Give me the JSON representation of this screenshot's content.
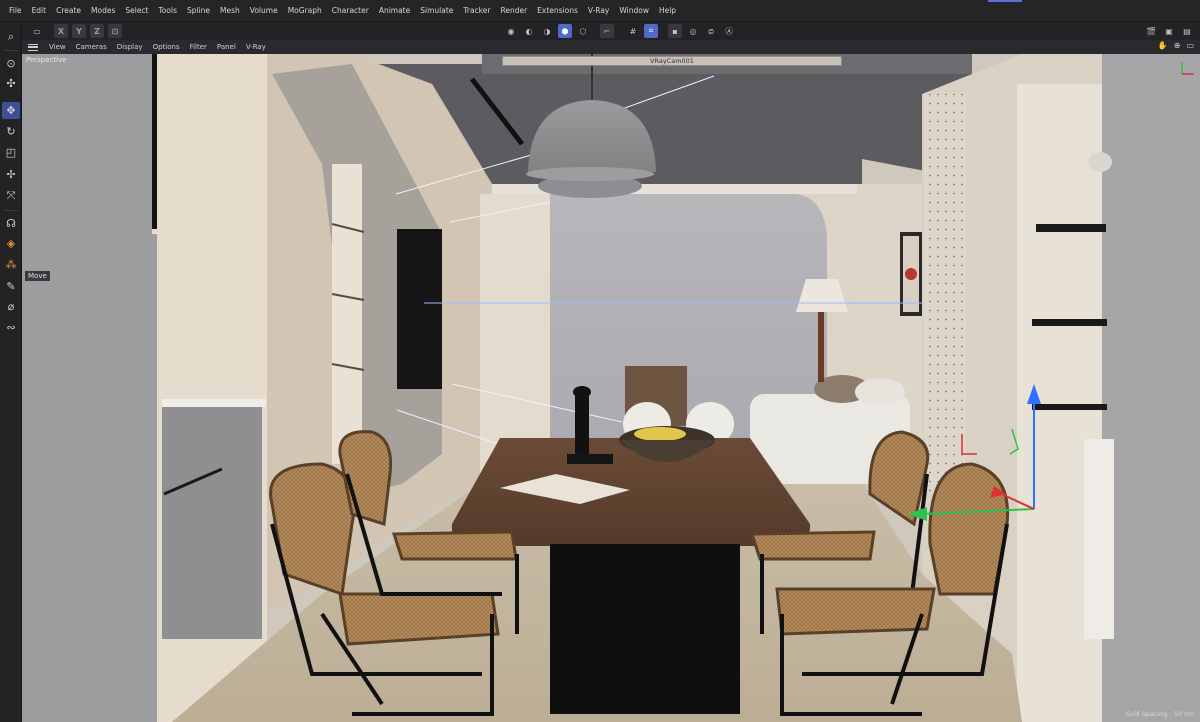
{
  "menu": [
    "File",
    "Edit",
    "Create",
    "Modes",
    "Select",
    "Tools",
    "Spline",
    "Mesh",
    "Volume",
    "MoGraph",
    "Character",
    "Animate",
    "Simulate",
    "Tracker",
    "Render",
    "Extensions",
    "V-Ray",
    "Window",
    "Help"
  ],
  "toolbar": {
    "axis_x": "X",
    "axis_y": "Y",
    "axis_z": "Z",
    "left_icons": [
      "undo-icon",
      "x-axis-lock",
      "y-axis-lock",
      "z-axis-lock",
      "world-coordinate-icon"
    ],
    "center_icons": [
      "points-mode-icon",
      "edges-mode-icon",
      "polygons-mode-icon",
      "model-mode-icon",
      "texture-mode-icon",
      "axis-mode-icon",
      "snap-icon",
      "snap-grid-icon",
      "workplane-icon",
      "solo-icon",
      "vray-icon"
    ],
    "right_icons": [
      "render-view-icon",
      "render-picture-queue-icon",
      "render-settings-icon"
    ]
  },
  "viewport_menu": [
    "View",
    "Cameras",
    "Display",
    "Options",
    "Filter",
    "Panel",
    "V-Ray"
  ],
  "viewport": {
    "label": "Perspective",
    "camera": "VRayCam001",
    "tooltip": "Move",
    "grid_spacing": "Grid Spacing : 50 cm"
  },
  "left_tools": [
    "search-icon",
    "live-selection-icon",
    "move-icon",
    "rotate-icon",
    "scale-icon",
    "transform-icon",
    "transfer-icon",
    "paint-icon",
    "sculpt-icon",
    "mograph-icon",
    "brush-icon",
    "knife-icon",
    "spline-pen-icon"
  ],
  "colors": {
    "accent": "#4f6ac7",
    "ui_bg": "#232326",
    "move_handle_x": "#e03030",
    "move_handle_y": "#2ec24a",
    "move_handle_z": "#2f72ff"
  }
}
